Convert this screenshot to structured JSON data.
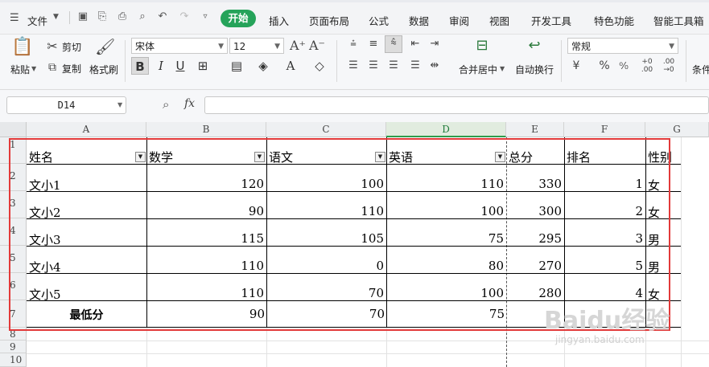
{
  "menu": {
    "file_label": "文件",
    "tabs": [
      "开始",
      "插入",
      "页面布局",
      "公式",
      "数据",
      "审阅",
      "视图",
      "开发工具",
      "特色功能",
      "智能工具箱"
    ],
    "active_tab": "开始"
  },
  "ribbon": {
    "paste_label": "粘贴",
    "cut_label": "剪切",
    "copy_label": "复制",
    "format_painter_label": "格式刷",
    "font_name": "宋体",
    "font_size": "12",
    "merge_center_label": "合并居中",
    "wrap_text_label": "自动换行",
    "number_format": "常规",
    "conditional_label": "条件"
  },
  "formula_bar": {
    "name_box": "D14",
    "fx_label": "fx",
    "value": ""
  },
  "grid": {
    "columns": [
      "A",
      "B",
      "C",
      "D",
      "E",
      "F",
      "G"
    ],
    "selected_column": "D",
    "rows": [
      "1",
      "2",
      "3",
      "4",
      "5",
      "6",
      "7",
      "8",
      "9",
      "10"
    ],
    "headers": [
      "姓名",
      "数学",
      "语文",
      "英语",
      "总分",
      "排名",
      "性别"
    ],
    "data_rows": [
      [
        "文小1",
        "120",
        "100",
        "110",
        "330",
        "1",
        "女"
      ],
      [
        "文小2",
        "90",
        "110",
        "100",
        "300",
        "2",
        "女"
      ],
      [
        "文小3",
        "115",
        "105",
        "75",
        "295",
        "3",
        "男"
      ],
      [
        "文小4",
        "110",
        "0",
        "80",
        "270",
        "5",
        "男"
      ],
      [
        "文小5",
        "110",
        "70",
        "100",
        "280",
        "4",
        "女"
      ]
    ],
    "min_row": [
      "最低分",
      "90",
      "70",
      "75"
    ]
  },
  "watermark": {
    "text": "Baidu经验",
    "sub": "jingyan.baidu.com"
  },
  "colors": {
    "accent_green": "#25a35a",
    "highlight_red": "#e23a3a",
    "selected_col": "#2e9b4c"
  }
}
